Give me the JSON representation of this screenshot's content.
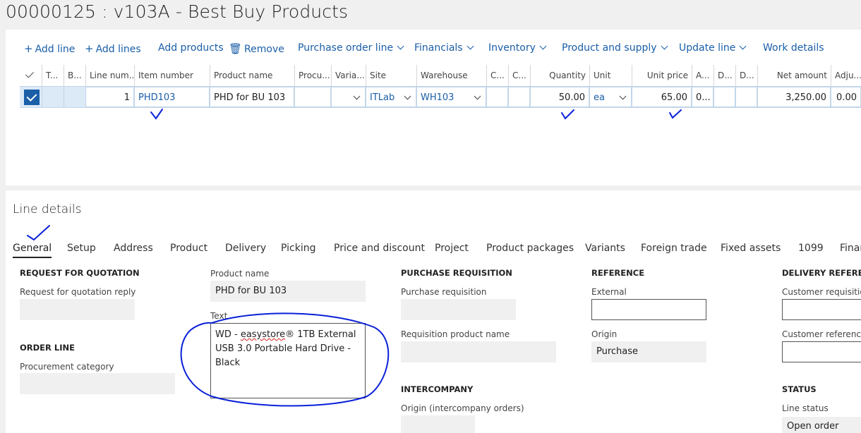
{
  "page": {
    "title": "00000125 : v103A - Best Buy Products"
  },
  "toolbar": {
    "add_line": "Add line",
    "add_lines": "Add lines",
    "add_products": "Add products",
    "remove": "Remove",
    "purchase_order_line": "Purchase order line",
    "financials": "Financials",
    "inventory": "Inventory",
    "product_and_supply": "Product and supply",
    "update_line": "Update line",
    "work_details": "Work details"
  },
  "grid": {
    "headers": {
      "type": "T...",
      "b": "B...",
      "line_number": "Line num...",
      "item_number": "Item number",
      "product_name": "Product name",
      "procurement": "Procu...",
      "variant": "Varia...",
      "site": "Site",
      "warehouse": "Warehouse",
      "c1": "C...",
      "c2": "C...",
      "quantity": "Quantity",
      "unit": "Unit",
      "unit_price": "Unit price",
      "a": "A...",
      "d1": "D...",
      "d2": "D...",
      "net_amount": "Net amount",
      "adjustment": "Adju..."
    },
    "row": {
      "line_number": "1",
      "item_number": "PHD103",
      "product_name": "PHD for BU 103",
      "site": "ITLab",
      "warehouse": "WH103",
      "quantity": "50.00",
      "unit": "ea",
      "unit_price": "65.00",
      "a": "0...",
      "net_amount": "3,250.00",
      "adjustment": "0.00"
    }
  },
  "details": {
    "title": "Line details",
    "tabs": [
      "General",
      "Setup",
      "Address",
      "Product",
      "Delivery",
      "Picking",
      "Price and discount",
      "Project",
      "Product packages",
      "Variants",
      "Foreign trade",
      "Fixed assets",
      "1099",
      "Finan"
    ],
    "rfq": {
      "heading": "REQUEST FOR QUOTATION",
      "reply_label": "Request for quotation reply",
      "reply_value": ""
    },
    "order_line": {
      "heading": "ORDER LINE",
      "category_label": "Procurement category",
      "category_value": ""
    },
    "product": {
      "name_label": "Product name",
      "name_value": "PHD for BU 103",
      "text_label": "Text",
      "text_before": "WD - ",
      "text_misspelled": "easystore",
      "text_after": "® 1TB External USB 3.0 Portable Hard Drive - Black"
    },
    "purchase_requisition": {
      "heading": "PURCHASE REQUISITION",
      "req_label": "Purchase requisition",
      "req_value": "",
      "req_product_label": "Requisition product name",
      "req_product_value": ""
    },
    "intercompany": {
      "heading": "INTERCOMPANY",
      "origin_label": "Origin (intercompany orders)",
      "origin_value": ""
    },
    "reference": {
      "heading": "REFERENCE",
      "external_label": "External",
      "external_value": "",
      "origin_label": "Origin",
      "origin_value": "Purchase"
    },
    "delivery_reference": {
      "heading": "DELIVERY REFERENCE",
      "customer_requisition_label": "Customer requisition",
      "customer_requisition_value": "",
      "customer_reference_label": "Customer reference",
      "customer_reference_value": ""
    },
    "status": {
      "heading": "STATUS",
      "line_status_label": "Line status",
      "line_status_value": "Open order"
    }
  },
  "colors": {
    "accent": "#1a5ea8",
    "selection": "#dce9f6",
    "annotation": "#0a20d8"
  }
}
